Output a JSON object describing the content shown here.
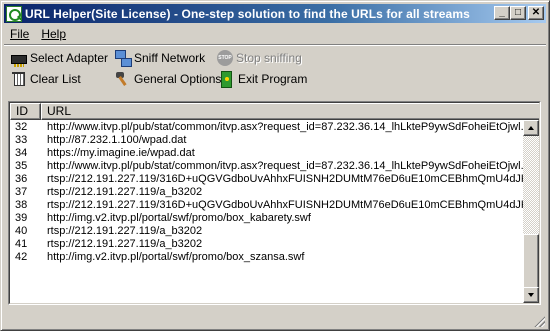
{
  "window": {
    "title": "URL Helper(Site License) - One-step solution to find the URLs for all streams",
    "buttons": {
      "minimize": "_",
      "maximize": "□",
      "close": "✕"
    }
  },
  "menu": [
    {
      "label": "File"
    },
    {
      "label": "Help"
    }
  ],
  "toolbar": {
    "select_adapter": {
      "label": "Select Adapter",
      "icon": "network-card-icon"
    },
    "sniff_network": {
      "label": "Sniff Network",
      "icon": "network-computers-icon"
    },
    "stop_sniffing": {
      "label": "Stop sniffing",
      "icon": "stop-icon",
      "icon_text": "STOP",
      "disabled": true
    },
    "clear_list": {
      "label": "Clear List",
      "icon": "trash-icon"
    },
    "general_options": {
      "label": "General Options",
      "icon": "tools-icon"
    },
    "exit_program": {
      "label": "Exit Program",
      "icon": "exit-door-icon"
    }
  },
  "list": {
    "columns": [
      "ID",
      "URL"
    ],
    "rows": [
      {
        "id": "32",
        "url": "http://www.itvp.pl/pub/stat/common/itvp.asx?request_id=87.232.36.14_lhLkteP9ywSdFoheiEtOjwl..."
      },
      {
        "id": "33",
        "url": "http://87.232.1.100/wpad.dat"
      },
      {
        "id": "34",
        "url": "https://my.imagine.ie/wpad.dat"
      },
      {
        "id": "35",
        "url": "http://www.itvp.pl/pub/stat/common/itvp.asx?request_id=87.232.36.14_lhLkteP9ywSdFoheiEtOjwl..."
      },
      {
        "id": "36",
        "url": "rtsp://212.191.227.119/316D+uQGVGdboUvAhhxFUISNH2DUMtM76eD6uE10mCEBhmQmU4dJK..."
      },
      {
        "id": "37",
        "url": "rtsp://212.191.227.119/a_b3202"
      },
      {
        "id": "38",
        "url": "rtsp://212.191.227.119/316D+uQGVGdboUvAhhxFUISNH2DUMtM76eD6uE10mCEBhmQmU4dJK..."
      },
      {
        "id": "39",
        "url": "http://img.v2.itvp.pl/portal/swf/promo/box_kabarety.swf"
      },
      {
        "id": "40",
        "url": "rtsp://212.191.227.119/a_b3202"
      },
      {
        "id": "41",
        "url": "rtsp://212.191.227.119/a_b3202"
      },
      {
        "id": "42",
        "url": "http://img.v2.itvp.pl/portal/swf/promo/box_szansa.swf"
      }
    ]
  },
  "colors": {
    "titlebar_start": "#0a246a",
    "titlebar_end": "#a6caf0",
    "face": "#d4d0c8"
  }
}
